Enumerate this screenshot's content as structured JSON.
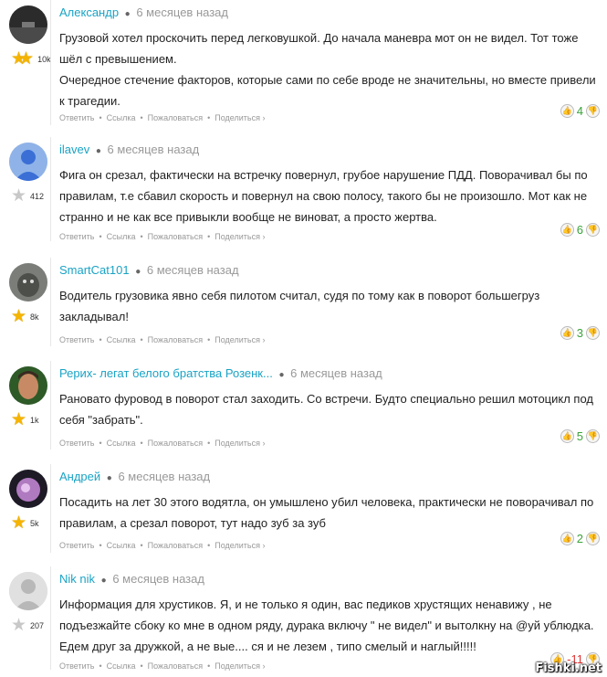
{
  "comments": [
    {
      "author": "Александр",
      "time": "6 месяцев назад",
      "rank_count": "10k",
      "stars": "1.5",
      "text": [
        "Грузовой хотел проскочить перед легковушкой. До начала маневра мот он не видел. Тот тоже шёл с превышением.",
        "Очередное стечение факторов, которые сами по себе вроде не значительны, но вместе привели к трагедии."
      ],
      "score": "4",
      "avatar": "avatar-dark-photo"
    },
    {
      "author": "ilavev",
      "time": "6 месяцев назад",
      "rank_count": "412",
      "stars": "0",
      "text": [
        "Фига он срезал, фактически на встречку повернул, грубое нарушение ПДД. Поворачивал бы по правилам, т.е сбавил скорость и повернул на свою полосу, такого бы не произошло. Мот как не странно и не как все привыкли вообще не виноват, а просто жертва."
      ],
      "score": "6",
      "avatar": "avatar-default-blue"
    },
    {
      "author": "SmartCat101",
      "time": "6 месяцев назад",
      "rank_count": "8k",
      "stars": "1",
      "text": [
        "Водитель грузовика явно себя пилотом считал, судя по тому как в поворот большегруз закладывал!"
      ],
      "score": "3",
      "avatar": "avatar-cat-photo"
    },
    {
      "author": "Рерих- легат белого братства Розенк...",
      "time": "6 месяцев назад",
      "rank_count": "1k",
      "stars": "1",
      "text": [
        "Рановато фуровод в поворот стал заходить. Со встречи. Будто специально решил мотоцикл под себя \"забрать\"."
      ],
      "score": "5",
      "avatar": "avatar-man-photo"
    },
    {
      "author": "Андрей",
      "time": "6 месяцев назад",
      "rank_count": "5k",
      "stars": "1",
      "text": [
        "Посадить на лет 30 этого водятла, он умышлено убил человека, практически не поворачивал по правилам, а срезал поворот, тут надо зуб за зуб"
      ],
      "score": "2",
      "avatar": "avatar-purple-photo"
    },
    {
      "author": "Nik nik",
      "time": "6 месяцев назад",
      "rank_count": "207",
      "stars": "0",
      "text": [
        "Информация для хрустиков. Я, и не только я один, вас педиков хрустящих ненавижу , не подъезжайте сбоку ко мне в одном ряду, дурака включу \" не видел\" и вытолкну на @уй ублюдка. Едем друг за дружкой, а не вые.... ся и не лезем , типо смелый и наглый!!!!!"
      ],
      "score": "-11",
      "avatar": "avatar-default-grey"
    }
  ],
  "actions": {
    "reply": "Ответить",
    "link": "Ссылка",
    "report": "Пожаловаться",
    "share": "Поделиться",
    "share_arrow": "›"
  },
  "watermark": "Fishki.net",
  "colors": {
    "author": "#1aa3c5",
    "positive": "#3aa33a",
    "negative": "#d33333",
    "star": "#f5b400"
  }
}
